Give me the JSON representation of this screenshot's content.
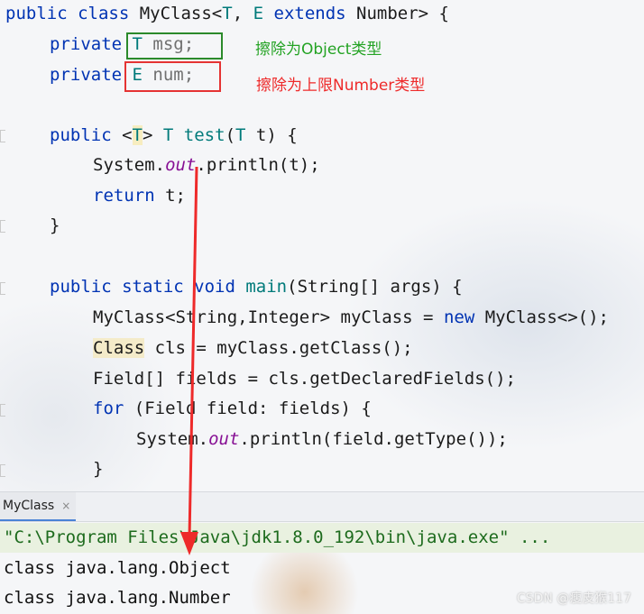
{
  "editor": {
    "line1": {
      "public_kw": "public",
      "class_kw": "class",
      "rest1": " MyClass<",
      "tparam_t": "T",
      "comma": ", ",
      "tparam_e": "E",
      "extends_kw": "extends",
      "rest2": " Number> {"
    },
    "line2": {
      "private_kw": "private",
      "type": "T",
      "name": " msg;"
    },
    "line3": {
      "private_kw": "private",
      "type": "E",
      "name": " num;"
    },
    "line4": {
      "public_kw": "public",
      "lt": "<",
      "tparam": "T",
      "gt": "> ",
      "ret_type": "T",
      "method": "test",
      "open": "(",
      "param_type": "T",
      "close": " t) {"
    },
    "line5": {
      "pre": "System.",
      "out": "out",
      "post": ".println(t);"
    },
    "line6": {
      "return_kw": "return",
      "post": " t;"
    },
    "line7": "}",
    "line8": {
      "kw": "public static void",
      "method": "main",
      "post": "(String[] args) {"
    },
    "line9": {
      "pre": "MyClass<String,Integer> myClass = ",
      "new_kw": "new",
      "post": " MyClass<>();"
    },
    "line10": {
      "cls_kw": "Class",
      "post": " cls = myClass.getClass();"
    },
    "line11": "Field[] fields = cls.getDeclaredFields();",
    "line12": {
      "for_kw": "for",
      "post": " (Field field: fields) {"
    },
    "line13": {
      "pre": "System.",
      "out": "out",
      "post": ".println(field.getType());"
    },
    "line14": "}"
  },
  "annotations": {
    "green_note": "擦除为Object类型",
    "red_note": "擦除为上限Number类型"
  },
  "run_panel": {
    "tab_label": "MyClass",
    "tab_close": "×",
    "command": "\"C:\\Program Files\\Java\\jdk1.8.0_192\\bin\\java.exe\" ...",
    "output": [
      "class java.lang.Object",
      "class java.lang.Number"
    ]
  },
  "watermark": "CSDN @瘦皮猴117",
  "colors": {
    "keyword": "#0033b3",
    "type_param": "#007a7a",
    "static_field": "#871094",
    "annotation_green": "#24a324",
    "annotation_red": "#ee2a2a",
    "arrow": "#ee2a2a"
  }
}
